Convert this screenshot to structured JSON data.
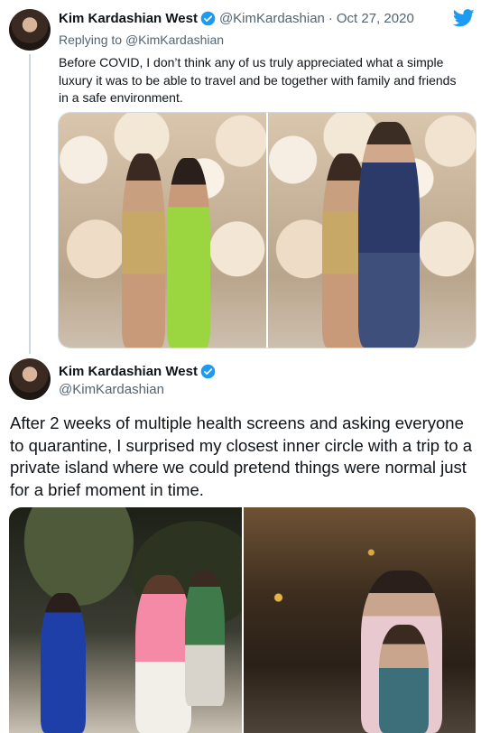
{
  "tweet1": {
    "author_name": "Kim Kardashian West",
    "handle": "@KimKardashian",
    "separator": "·",
    "date": "Oct 27, 2020",
    "replying_prefix": "Replying to",
    "replying_to": "@KimKardashian",
    "text": "Before COVID, I don’t think any of us truly appreciated what a simple luxury it was to be able to travel and be together with family and friends in a safe environment."
  },
  "tweet2": {
    "author_name": "Kim Kardashian West",
    "handle": "@KimKardashian",
    "text": "After 2 weeks of multiple health screens and asking everyone to quarantine, I surprised my closest inner circle with a trip to a private island where we could pretend things were normal just for a brief moment in time."
  },
  "icons": [
    "twitter-bird-icon",
    "verified-badge-icon"
  ],
  "colors": {
    "twitter_blue": "#1d9bf0",
    "text": "#0f1419",
    "muted": "#536471",
    "thread_line": "#cfd9de"
  }
}
